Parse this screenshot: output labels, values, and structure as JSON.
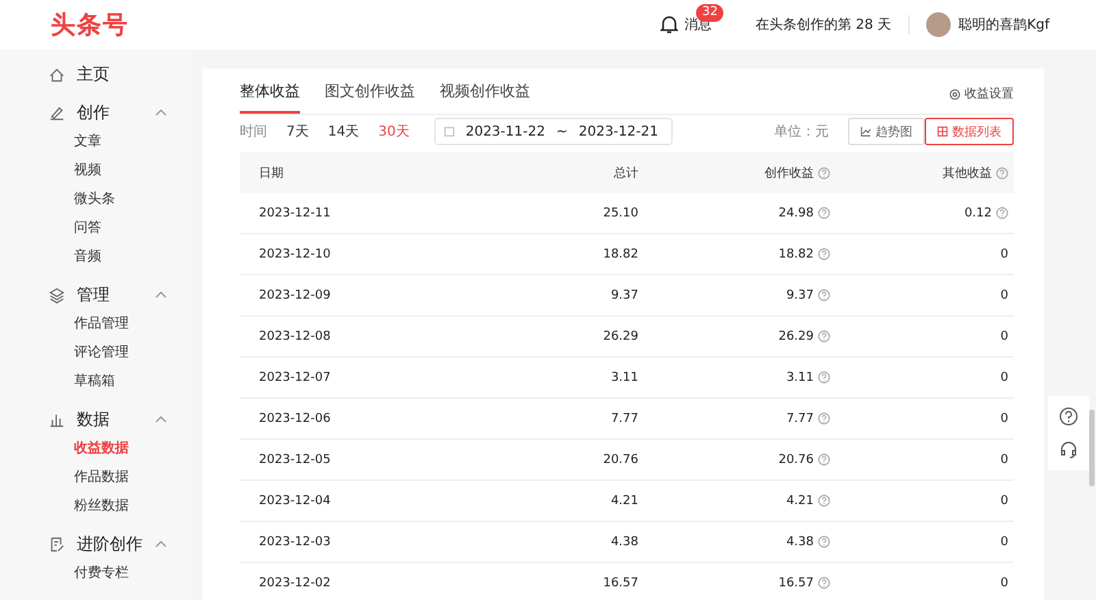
{
  "header": {
    "logo": "头条号",
    "messages": {
      "label": "消息",
      "badge": "32"
    },
    "days_text": "在头条创作的第 28 天",
    "user": {
      "name": "聪明的喜鹊Kgf"
    }
  },
  "sidebar": {
    "groups": [
      {
        "label": "主页"
      },
      {
        "label": "创作",
        "expanded": true,
        "children": [
          {
            "label": "文章",
            "selected": false
          },
          {
            "label": "视频",
            "selected": false
          },
          {
            "label": "微头条",
            "selected": false
          },
          {
            "label": "问答",
            "selected": false
          },
          {
            "label": "音频",
            "selected": false
          }
        ]
      },
      {
        "label": "管理",
        "expanded": true,
        "children": [
          {
            "label": "作品管理",
            "selected": false
          },
          {
            "label": "评论管理",
            "selected": false
          },
          {
            "label": "草稿箱",
            "selected": false
          }
        ]
      },
      {
        "label": "数据",
        "expanded": true,
        "children": [
          {
            "label": "收益数据",
            "selected": true
          },
          {
            "label": "作品数据",
            "selected": false
          },
          {
            "label": "粉丝数据",
            "selected": false
          }
        ]
      },
      {
        "label": "进阶创作",
        "expanded": true,
        "children": [
          {
            "label": "付费专栏",
            "selected": false
          }
        ]
      }
    ]
  },
  "tabs": [
    {
      "label": "整体收益",
      "selected": true
    },
    {
      "label": "图文创作收益",
      "selected": false
    },
    {
      "label": "视频创作收益",
      "selected": false
    }
  ],
  "settings_link": "收益设置",
  "filters": {
    "label": "时间",
    "ranges": [
      {
        "label": "7天",
        "selected": false
      },
      {
        "label": "14天",
        "selected": false
      },
      {
        "label": "30天",
        "selected": true
      }
    ],
    "date_from": "2023-11-22",
    "separator": "~",
    "date_to": "2023-12-21",
    "unit": "单位：元",
    "views": [
      {
        "kind": "trend",
        "label": "趋势图",
        "selected": false
      },
      {
        "kind": "table",
        "label": "数据列表",
        "selected": true
      }
    ]
  },
  "table": {
    "columns": [
      "日期",
      "总计",
      "创作收益",
      "其他收益"
    ],
    "rows": [
      {
        "date": "2023-12-11",
        "total": "25.10",
        "creation": "24.98",
        "other": "0.12",
        "other_info": true
      },
      {
        "date": "2023-12-10",
        "total": "18.82",
        "creation": "18.82",
        "other": "0",
        "other_info": false
      },
      {
        "date": "2023-12-09",
        "total": "9.37",
        "creation": "9.37",
        "other": "0",
        "other_info": false
      },
      {
        "date": "2023-12-08",
        "total": "26.29",
        "creation": "26.29",
        "other": "0",
        "other_info": false
      },
      {
        "date": "2023-12-07",
        "total": "3.11",
        "creation": "3.11",
        "other": "0",
        "other_info": false
      },
      {
        "date": "2023-12-06",
        "total": "7.77",
        "creation": "7.77",
        "other": "0",
        "other_info": false
      },
      {
        "date": "2023-12-05",
        "total": "20.76",
        "creation": "20.76",
        "other": "0",
        "other_info": false
      },
      {
        "date": "2023-12-04",
        "total": "4.21",
        "creation": "4.21",
        "other": "0",
        "other_info": false
      },
      {
        "date": "2023-12-03",
        "total": "4.38",
        "creation": "4.38",
        "other": "0",
        "other_info": false
      },
      {
        "date": "2023-12-02",
        "total": "16.57",
        "creation": "16.57",
        "other": "0",
        "other_info": false
      }
    ]
  }
}
